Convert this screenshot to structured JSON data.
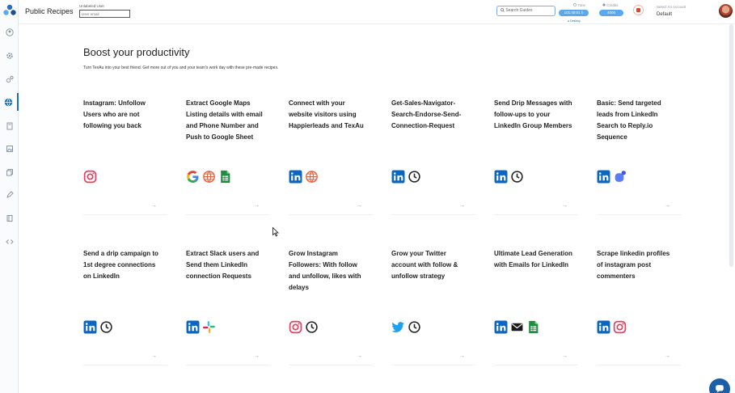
{
  "header": {
    "title": "Public Recipes",
    "unlabeled_user_label": "Unlabeled User",
    "user_email_placeholder": "User email",
    "search_placeholder": "Search Guides",
    "time": {
      "label": "Time",
      "value": "101:40:01 h"
    },
    "desktop_label": "● Desktop",
    "credits": {
      "label": "Credits",
      "value": "4000"
    },
    "account": {
      "label": "Select An Account",
      "value": "Default"
    }
  },
  "main": {
    "heading": "Boost your productivity",
    "subheading": "Turn TexAu into your best friend. Get more out of you and your team's work day with these pre-made recipes."
  },
  "cards": [
    {
      "title": "Instagram: Unfollow Users who are not following you back",
      "icons": [
        "instagram-icon"
      ]
    },
    {
      "title": "Extract Google Maps Listing details with email and Phone Number and Push to Google Sheet",
      "icons": [
        "google-icon",
        "web-icon",
        "google-sheets-icon"
      ]
    },
    {
      "title": "Connect with your website visitors using Happierleads and TexAu",
      "icons": [
        "linkedin-icon",
        "web-icon"
      ]
    },
    {
      "title": "Get-Sales-Navigator-Search-Endorse-Send-Connection-Request",
      "icons": [
        "linkedin-icon",
        "clock-icon"
      ]
    },
    {
      "title": "Send Drip Messages with follow-ups to your LinkedIn Group Members",
      "icons": [
        "linkedin-icon",
        "clock-icon"
      ]
    },
    {
      "title": "Basic: Send targeted leads from LinkedIn Search to Reply.io Sequence",
      "icons": [
        "linkedin-icon",
        "reply-io-icon"
      ]
    },
    {
      "title": "Send a drip campaign to 1st degree connections on LinkedIn",
      "icons": [
        "linkedin-icon",
        "clock-icon"
      ]
    },
    {
      "title": "Extract Slack users and Send them LinkedIn connection Requests",
      "icons": [
        "linkedin-icon",
        "slack-icon"
      ]
    },
    {
      "title": "Grow Instagram Followers: With follow and unfollow, likes with delays",
      "icons": [
        "instagram-icon",
        "clock-icon"
      ]
    },
    {
      "title": "Grow your Twitter account with follow & unfollow strategy",
      "icons": [
        "twitter-icon",
        "clock-icon"
      ]
    },
    {
      "title": "Ultimate Lead Generation with Emails for LinkedIn",
      "icons": [
        "linkedin-icon",
        "email-icon",
        "google-sheets-icon"
      ]
    },
    {
      "title": "Scrape linkedin profiles of instagram post commenters",
      "icons": [
        "linkedin-icon",
        "instagram-icon"
      ]
    }
  ],
  "card_arrow": "→",
  "colors": {
    "accent": "#1c6fb5",
    "linkedin": "#0a66c2",
    "instagram": "#e4405f",
    "twitter": "#1da1f2",
    "sheets": "#1e8e3e"
  }
}
